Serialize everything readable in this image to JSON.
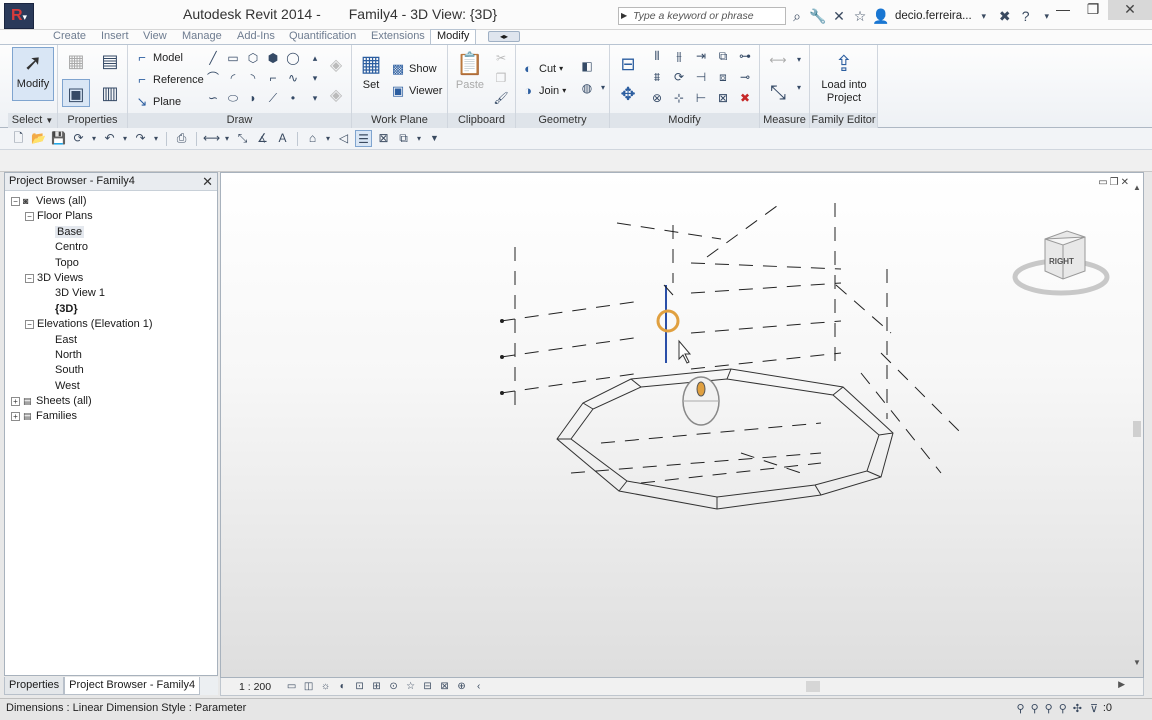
{
  "window": {
    "app_name": "Autodesk Revit 2014 -",
    "doc_title": "Family4 - 3D View: {3D}",
    "search_placeholder": "Type a keyword or phrase",
    "user": "decio.ferreira..."
  },
  "ribbon_tabs": [
    {
      "label": "Create"
    },
    {
      "label": "Insert"
    },
    {
      "label": "View"
    },
    {
      "label": "Manage"
    },
    {
      "label": "Add-Ins"
    },
    {
      "label": "Quantification"
    },
    {
      "label": "Extensions"
    },
    {
      "label": "Modify"
    }
  ],
  "ribbon": {
    "select": {
      "label": "Select",
      "modify_btn": "Modify"
    },
    "properties": {
      "label": "Properties"
    },
    "draw": {
      "label": "Draw",
      "model": "Model",
      "reference": "Reference",
      "plane": "Plane"
    },
    "work_plane": {
      "label": "Work Plane",
      "set": "Set",
      "show": "Show",
      "viewer": "Viewer"
    },
    "clipboard": {
      "label": "Clipboard",
      "paste": "Paste"
    },
    "geometry": {
      "label": "Geometry",
      "cut": "Cut",
      "join": "Join"
    },
    "modify": {
      "label": "Modify"
    },
    "measure": {
      "label": "Measure"
    },
    "family_editor": {
      "label": "Family Editor",
      "load_line1": "Load into",
      "load_line2": "Project"
    }
  },
  "project_browser": {
    "title": "Project Browser - Family4",
    "tree": [
      {
        "label": "Views (all)",
        "level": 0,
        "expander": "−",
        "icon": "views-icon"
      },
      {
        "label": "Floor Plans",
        "level": 1,
        "expander": "−"
      },
      {
        "label": "Base",
        "level": 2,
        "selected": true
      },
      {
        "label": "Centro",
        "level": 2
      },
      {
        "label": "Topo",
        "level": 2
      },
      {
        "label": "3D Views",
        "level": 1,
        "expander": "−"
      },
      {
        "label": "3D View 1",
        "level": 2
      },
      {
        "label": "{3D}",
        "level": 2,
        "bold": true
      },
      {
        "label": "Elevations (Elevation 1)",
        "level": 1,
        "expander": "−"
      },
      {
        "label": "East",
        "level": 2
      },
      {
        "label": "North",
        "level": 2
      },
      {
        "label": "South",
        "level": 2
      },
      {
        "label": "West",
        "level": 2
      },
      {
        "label": "Sheets (all)",
        "level": 0,
        "expander": "+",
        "icon": "sheets-icon"
      },
      {
        "label": "Families",
        "level": 0,
        "expander": "+",
        "icon": "families-icon"
      }
    ],
    "tabs": [
      {
        "label": "Properties"
      },
      {
        "label": "Project Browser - Family4"
      }
    ]
  },
  "viewcube": {
    "face": "RIGHT"
  },
  "view_control": {
    "scale": "1 : 200"
  },
  "status": {
    "text": "Dimensions : Linear Dimension Style : Parameter",
    "selection_count": ":0"
  }
}
